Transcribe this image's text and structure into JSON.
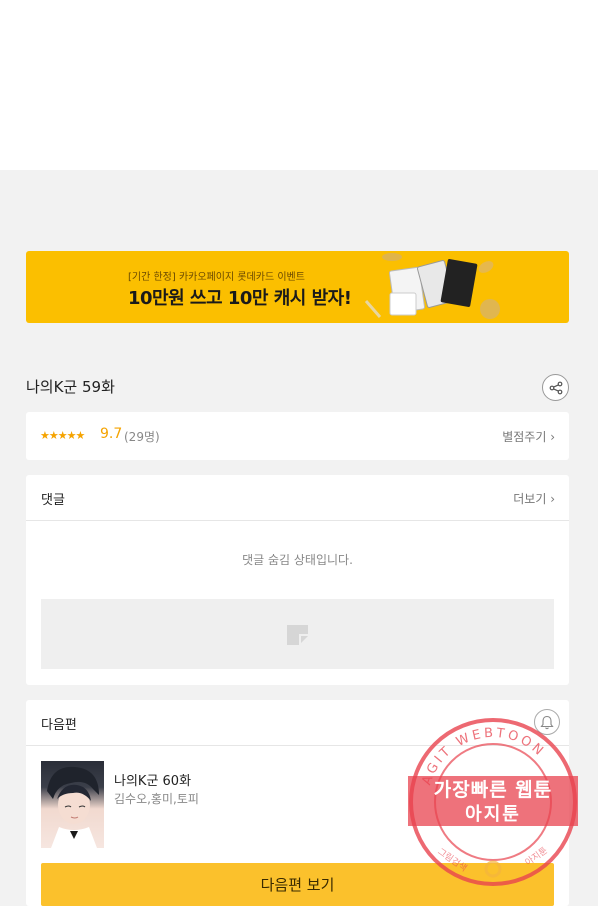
{
  "banner": {
    "subtitle": "[기간 한정] 카카오페이지 롯데카드 이벤트",
    "headline": "10만원 쓰고 10만 캐시 받자!"
  },
  "episode": {
    "title": "나의K군 59화"
  },
  "rating": {
    "stars": "★★★★★",
    "score": "9.7",
    "count": "(29명)",
    "rate_label": "별점주기 ›"
  },
  "comments": {
    "label": "댓글",
    "more_label": "더보기 ›",
    "hidden_message": "댓글 숨김 상태입니다."
  },
  "next": {
    "label": "다음편",
    "title": "나의K군 60화",
    "authors": "김수오,홍미,토피",
    "button_label": "다음편 보기"
  },
  "watermark": {
    "line1": "가장빠른 웹툰",
    "line2": "아지툰",
    "ring_top": "AGIT WEBTOON",
    "ring_left": "그림검색",
    "ring_right": "아지툰"
  },
  "colors": {
    "banner_bg": "#fbbf00",
    "accent_star": "#f5a300",
    "next_button": "#fbc12c",
    "stamp_red": "#e8434f"
  }
}
